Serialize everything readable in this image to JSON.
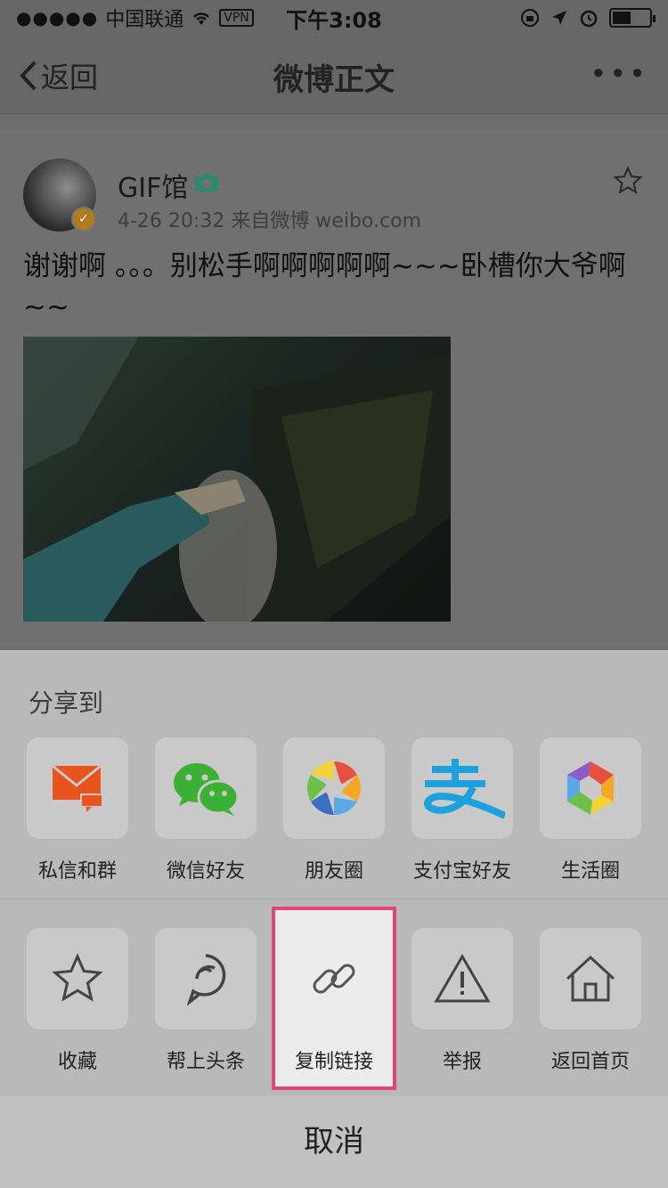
{
  "status_bar": {
    "signal": "●●●●●",
    "carrier": "中国联通",
    "vpn": "VPN",
    "time": "下午3:08"
  },
  "nav": {
    "back_label": "返回",
    "title": "微博正文",
    "more": "•••"
  },
  "post": {
    "username": "GIF馆",
    "meta": "4-26 20:32  来自微博 weibo.com",
    "text": "谢谢啊 。。。别松手啊啊啊啊啊~~~卧槽你大爷啊~~"
  },
  "share": {
    "title": "分享到",
    "row1": [
      {
        "label": "私信和群",
        "icon": "envelope-icon"
      },
      {
        "label": "微信好友",
        "icon": "wechat-icon"
      },
      {
        "label": "朋友圈",
        "icon": "moments-icon"
      },
      {
        "label": "支付宝好友",
        "icon": "alipay-icon"
      },
      {
        "label": "生活圈",
        "icon": "life-circle-icon"
      }
    ],
    "row2": [
      {
        "label": "收藏",
        "icon": "star-icon"
      },
      {
        "label": "帮上头条",
        "icon": "headline-icon"
      },
      {
        "label": "复制链接",
        "icon": "link-icon"
      },
      {
        "label": "举报",
        "icon": "warning-icon"
      },
      {
        "label": "返回首页",
        "icon": "home-icon"
      }
    ],
    "cancel": "取消"
  },
  "colors": {
    "highlight": "#e0457b",
    "envelope": "#e8541c",
    "wechat": "#3cb034",
    "alipay": "#1da1dc"
  }
}
